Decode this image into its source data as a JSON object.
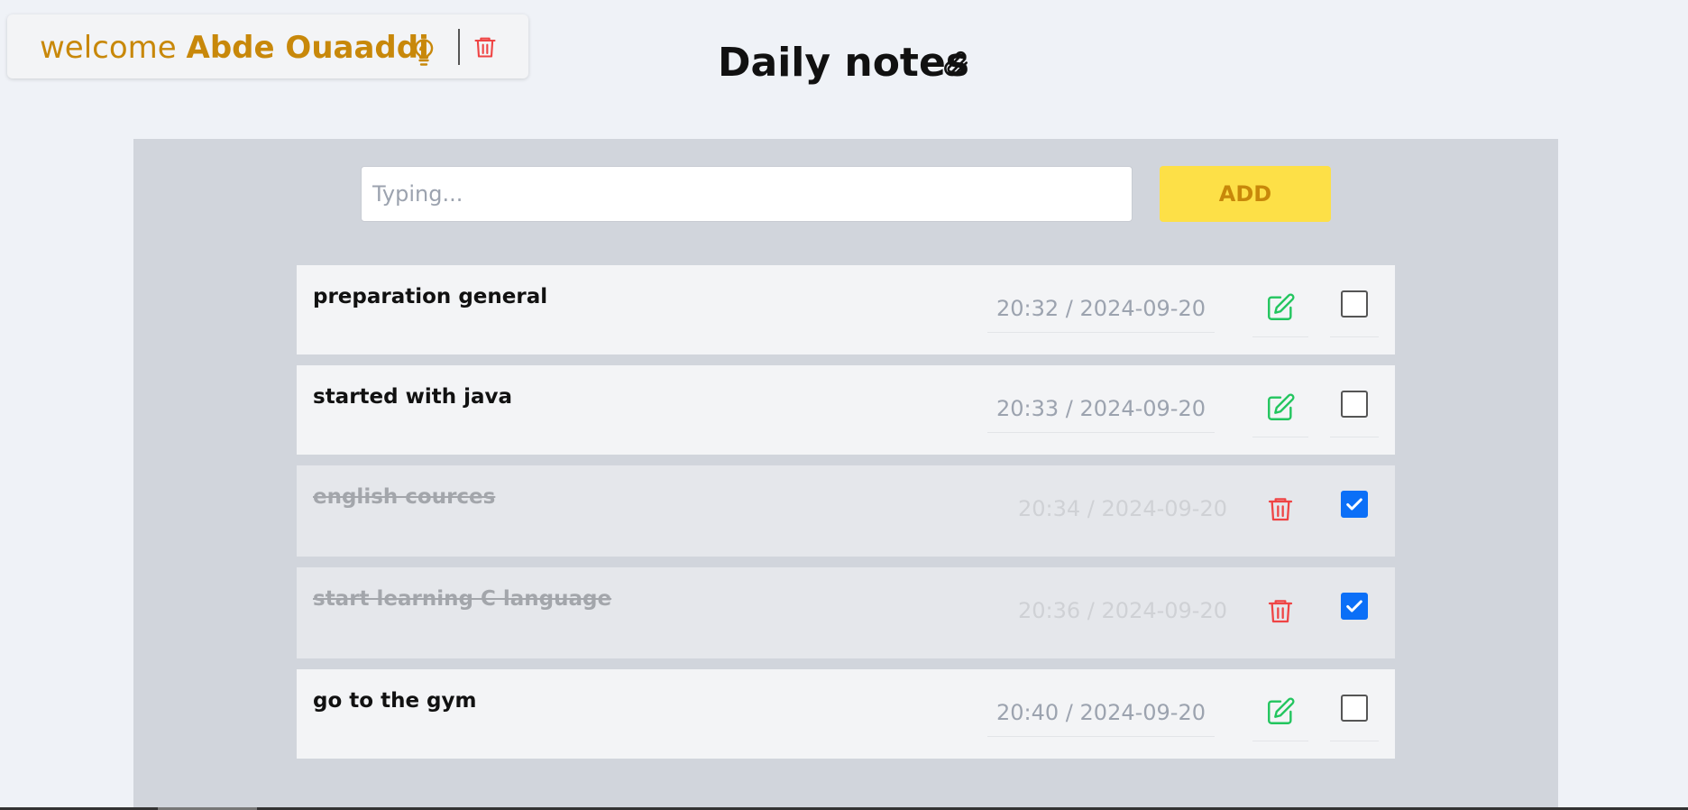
{
  "header": {
    "welcome_prefix": "welcome",
    "user_name": "Abde Ouaaddi",
    "title": "Daily notes"
  },
  "input": {
    "placeholder": "Typing...",
    "value": ""
  },
  "add_label": "ADD",
  "notes": [
    {
      "text": "preparation general",
      "time": "20:32 / 2024-09-20",
      "done": false,
      "action_icon": "edit-icon"
    },
    {
      "text": "started with java",
      "time": "20:33 / 2024-09-20",
      "done": false,
      "action_icon": "edit-icon"
    },
    {
      "text": "english cources",
      "time": "20:34 / 2024-09-20",
      "done": true,
      "action_icon": "trash-icon"
    },
    {
      "text": "start learning C language",
      "time": "20:36 / 2024-09-20",
      "done": true,
      "action_icon": "trash-icon"
    },
    {
      "text": "go to the gym",
      "time": "20:40 / 2024-09-20",
      "done": false,
      "action_icon": "edit-icon"
    }
  ],
  "colors": {
    "accent": "#c8880a",
    "add_button": "#fde047",
    "edit": "#22c55e",
    "delete": "#ef4444",
    "checkbox_checked": "#0b6ff7"
  },
  "icons": [
    "lightbulb-icon",
    "trash-icon",
    "paperclip-icon",
    "edit-icon",
    "checkbox-icon"
  ]
}
